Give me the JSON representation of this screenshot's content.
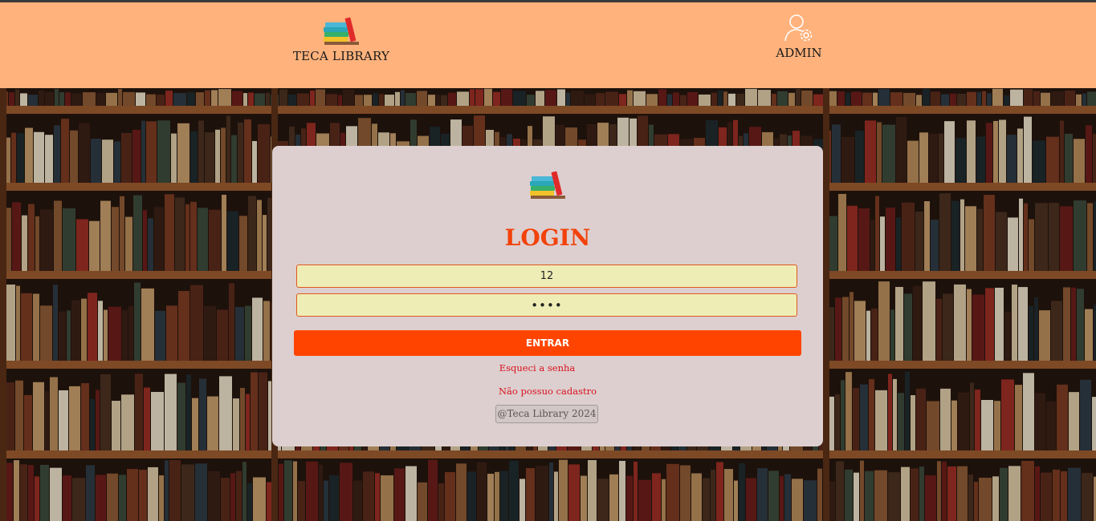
{
  "header": {
    "brand_name": "TECA LIBRARY",
    "admin_label": "ADMIN"
  },
  "login": {
    "title": "LOGIN",
    "user_value": "12",
    "password_value": "••••",
    "submit_label": "ENTRAR",
    "forgot_link": "Esqueci a senha",
    "signup_link": "Não possuo cadastro",
    "footer": "@Teca Library 2024"
  },
  "icons": {
    "brand_logo": "books-stack-icon",
    "admin": "user-gear-icon"
  },
  "colors": {
    "header_bg": "#ffb27c",
    "accent": "#ff4400",
    "card_bg": "#ddcfcf",
    "input_bg": "#efedb6",
    "link": "#d9121e"
  }
}
